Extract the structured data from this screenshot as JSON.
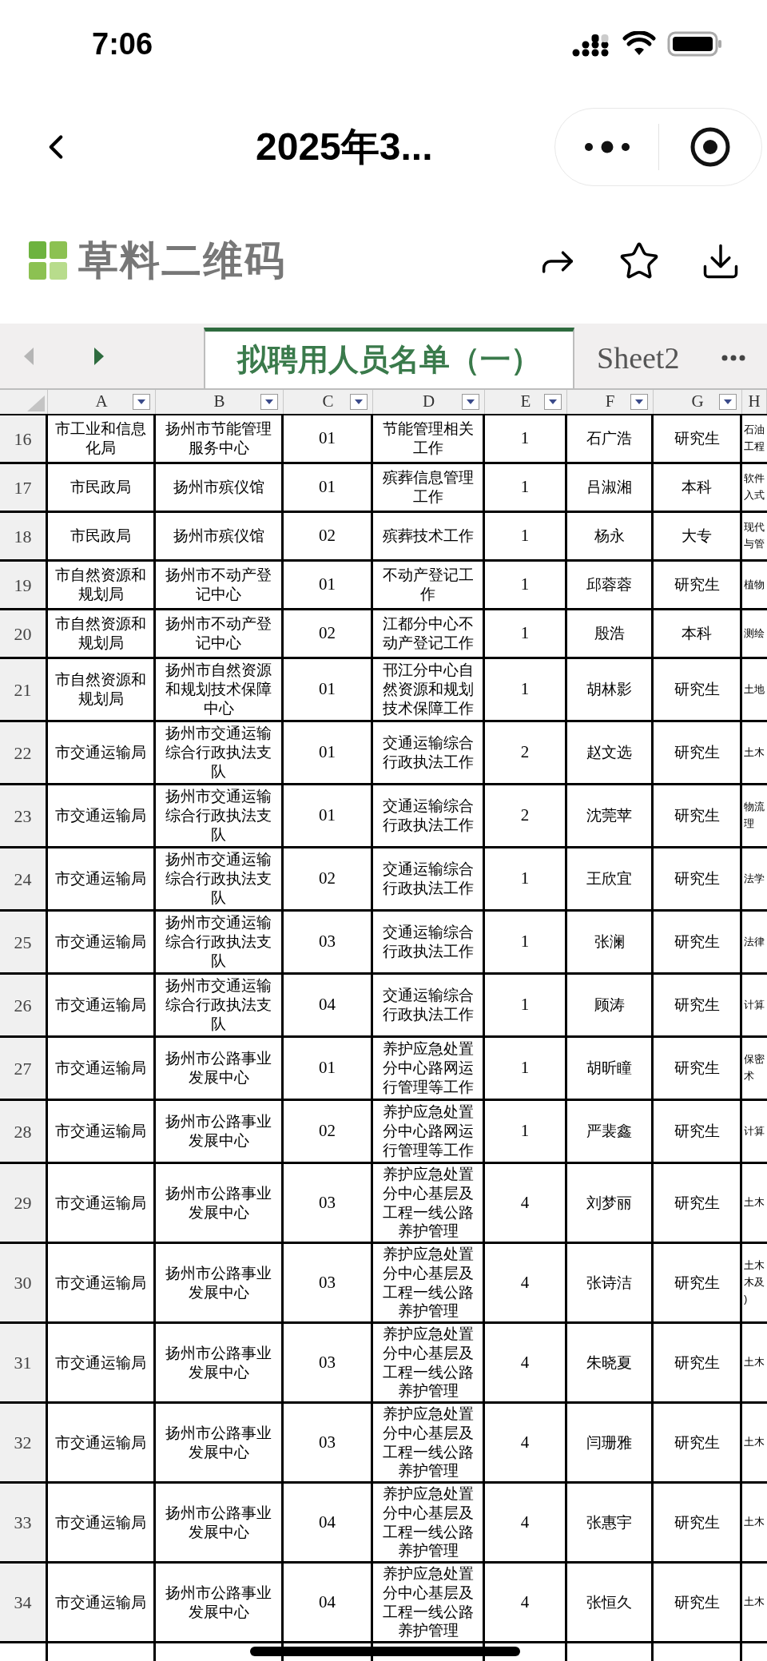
{
  "status_bar": {
    "time": "7:06"
  },
  "nav": {
    "title": "2025年3..."
  },
  "brand": {
    "name": "草料二维码"
  },
  "sheet_tabs": [
    {
      "label": "拟聘用人员名单（一）",
      "selected": true
    },
    {
      "label": "Sheet2",
      "selected": false
    }
  ],
  "columns": [
    "A",
    "B",
    "C",
    "D",
    "E",
    "F",
    "G",
    "H"
  ],
  "rows": [
    {
      "number": "16",
      "cells": [
        "市工业和信息化局",
        "扬州市节能管理服务中心",
        "01",
        "节能管理相关工作",
        "1",
        "石广浩",
        "研究生",
        "石油工程"
      ]
    },
    {
      "number": "17",
      "cells": [
        "市民政局",
        "扬州市殡仪馆",
        "01",
        "殡葬信息管理工作",
        "1",
        "吕淑湘",
        "本科",
        "软件入式"
      ]
    },
    {
      "number": "18",
      "cells": [
        "市民政局",
        "扬州市殡仪馆",
        "02",
        "殡葬技术工作",
        "1",
        "杨永",
        "大专",
        "现代与管"
      ]
    },
    {
      "number": "19",
      "cells": [
        "市自然资源和规划局",
        "扬州市不动产登记中心",
        "01",
        "不动产登记工作",
        "1",
        "邱蓉蓉",
        "研究生",
        "植物"
      ]
    },
    {
      "number": "20",
      "cells": [
        "市自然资源和规划局",
        "扬州市不动产登记中心",
        "02",
        "江都分中心不动产登记工作",
        "1",
        "殷浩",
        "本科",
        "测绘"
      ]
    },
    {
      "number": "21",
      "cells": [
        "市自然资源和规划局",
        "扬州市自然资源和规划技术保障中心",
        "01",
        "邗江分中心自然资源和规划技术保障工作",
        "1",
        "胡林影",
        "研究生",
        "土地"
      ]
    },
    {
      "number": "22",
      "cells": [
        "市交通运输局",
        "扬州市交通运输综合行政执法支队",
        "01",
        "交通运输综合行政执法工作",
        "2",
        "赵文选",
        "研究生",
        "土木"
      ]
    },
    {
      "number": "23",
      "cells": [
        "市交通运输局",
        "扬州市交通运输综合行政执法支队",
        "01",
        "交通运输综合行政执法工作",
        "2",
        "沈莞苹",
        "研究生",
        "物流理"
      ]
    },
    {
      "number": "24",
      "cells": [
        "市交通运输局",
        "扬州市交通运输综合行政执法支队",
        "02",
        "交通运输综合行政执法工作",
        "1",
        "王欣宜",
        "研究生",
        "法学"
      ]
    },
    {
      "number": "25",
      "cells": [
        "市交通运输局",
        "扬州市交通运输综合行政执法支队",
        "03",
        "交通运输综合行政执法工作",
        "1",
        "张澜",
        "研究生",
        "法律"
      ]
    },
    {
      "number": "26",
      "cells": [
        "市交通运输局",
        "扬州市交通运输综合行政执法支队",
        "04",
        "交通运输综合行政执法工作",
        "1",
        "顾涛",
        "研究生",
        "计算"
      ]
    },
    {
      "number": "27",
      "cells": [
        "市交通运输局",
        "扬州市公路事业发展中心",
        "01",
        "养护应急处置分中心路网运行管理等工作",
        "1",
        "胡昕瞳",
        "研究生",
        "保密术"
      ]
    },
    {
      "number": "28",
      "cells": [
        "市交通运输局",
        "扬州市公路事业发展中心",
        "02",
        "养护应急处置分中心路网运行管理等工作",
        "1",
        "严裴鑫",
        "研究生",
        "计算"
      ]
    },
    {
      "number": "29",
      "cells": [
        "市交通运输局",
        "扬州市公路事业发展中心",
        "03",
        "养护应急处置分中心基层及工程一线公路养护管理",
        "4",
        "刘梦丽",
        "研究生",
        "土木"
      ]
    },
    {
      "number": "30",
      "cells": [
        "市交通运输局",
        "扬州市公路事业发展中心",
        "03",
        "养护应急处置分中心基层及工程一线公路养护管理",
        "4",
        "张诗洁",
        "研究生",
        "土木木及)"
      ]
    },
    {
      "number": "31",
      "cells": [
        "市交通运输局",
        "扬州市公路事业发展中心",
        "03",
        "养护应急处置分中心基层及工程一线公路养护管理",
        "4",
        "朱晓夏",
        "研究生",
        "土木"
      ]
    },
    {
      "number": "32",
      "cells": [
        "市交通运输局",
        "扬州市公路事业发展中心",
        "03",
        "养护应急处置分中心基层及工程一线公路养护管理",
        "4",
        "闫珊雅",
        "研究生",
        "土木"
      ]
    },
    {
      "number": "33",
      "cells": [
        "市交通运输局",
        "扬州市公路事业发展中心",
        "04",
        "养护应急处置分中心基层及工程一线公路养护管理",
        "4",
        "张惠宇",
        "研究生",
        "土木"
      ]
    },
    {
      "number": "34",
      "cells": [
        "市交通运输局",
        "扬州市公路事业发展中心",
        "04",
        "养护应急处置分中心基层及工程一线公路养护管理",
        "4",
        "张恒久",
        "研究生",
        "土木"
      ]
    }
  ]
}
